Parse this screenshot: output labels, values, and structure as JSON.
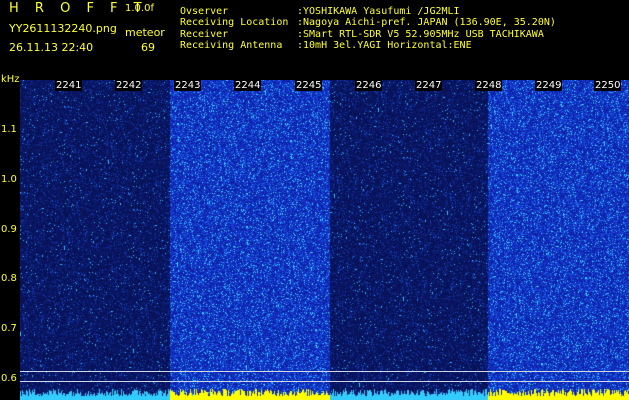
{
  "header": {
    "app_title": "H R O F F T",
    "version": "1.0.0f",
    "file_name": "YY2611132240.png",
    "meteor_label": "meteor",
    "date_time": "26.11.13 22:40",
    "meteor_count": "69"
  },
  "station_info": [
    {
      "label": "Ovserver",
      "value": ":YOSHIKAWA Yasufumi /JG2MLI"
    },
    {
      "label": "Receiving Location",
      "value": ":Nagoya Aichi-pref. JAPAN (136.90E, 35.20N)"
    },
    {
      "label": "Receiver",
      "value": ":SMart RTL-SDR V5 52.905MHz USB TACHIKAWA"
    },
    {
      "label": "Receiving Antenna",
      "value": ":10mH 3el.YAGI Horizontal:ENE"
    }
  ],
  "axis": {
    "unit": "kHz",
    "ticks": [
      "1.1",
      "1.0",
      "0.9",
      "0.8",
      "0.7",
      "0.6"
    ]
  },
  "minute_labels": [
    "2241",
    "2242",
    "2243",
    "2244",
    "2245",
    "2246",
    "2247",
    "2248",
    "2249",
    "2250"
  ],
  "colors": {
    "text": "#ffff33",
    "dark_band": "#0a1a66",
    "bright_band": "#1e3fd0",
    "speck": "#3fd0ff",
    "baseline_bright": "#ffff00",
    "baseline_dark": "#33ccff"
  }
}
